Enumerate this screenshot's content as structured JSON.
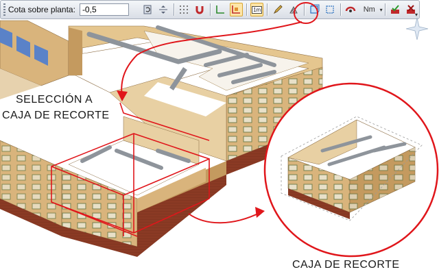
{
  "toolbar": {
    "elevation_label": "Cota sobre planta:",
    "elevation_value": "-0,5",
    "scale_button": "1m",
    "nm_label": "Nm"
  },
  "annotations": {
    "selection_line1": "SELECCIÓN A",
    "selection_line2": "CAJA DE RECORTE",
    "result_caption": "CAJA DE RECORTE"
  },
  "colors": {
    "highlight": "#e0161b",
    "wall": "#d9b47c",
    "wall_dark": "#b88a52",
    "brick": "#8a3a24",
    "duct": "#8e949b",
    "floor": "#ffffff"
  },
  "icons": [
    "grip-icon",
    "refresh-icon",
    "center-icon",
    "grid-icon",
    "magnet-icon",
    "axis-icon",
    "ortho-icon",
    "scale-icon",
    "pencil-icon",
    "hatch-icon",
    "clip-box-icon",
    "clip-box-alt-icon",
    "orbit-icon",
    "nm-icon",
    "check-icon",
    "delete-check-icon"
  ]
}
